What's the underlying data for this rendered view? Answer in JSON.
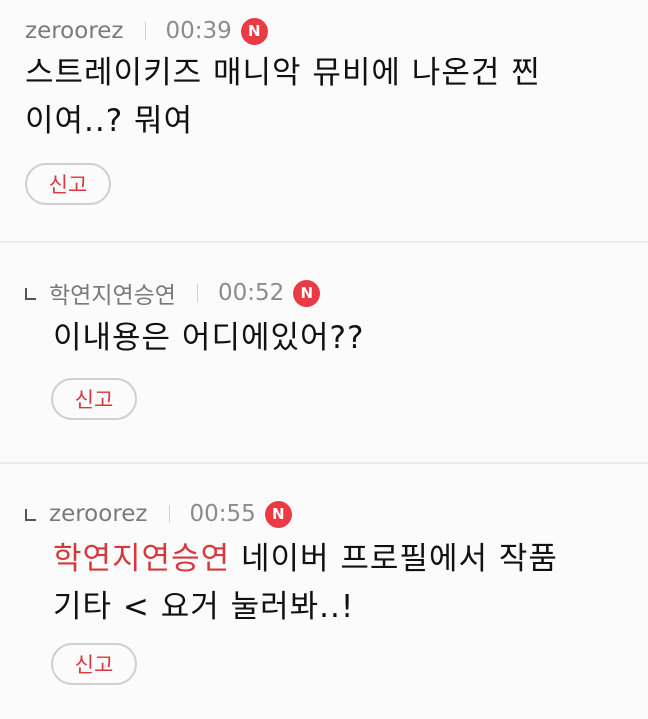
{
  "comments": [
    {
      "author": "zeroorez",
      "time": "00:39",
      "badge": "N",
      "text": "스트레이키즈 매니악 뮤비에 나온건 찐이여..? 뭐여",
      "line1": "스트레이키즈 매니악 뮤비에 나온건 찐",
      "line2": "이여..? 뭐여",
      "report_label": "신고"
    },
    {
      "author": "학연지연승연",
      "time": "00:52",
      "badge": "N",
      "text": "이내용은 어디에있어??",
      "report_label": "신고"
    },
    {
      "author": "zeroorez",
      "time": "00:55",
      "badge": "N",
      "mention": "학연지연승연",
      "line1_rest": " 네이버 프로필에서 작품",
      "line2": "기타 < 요거 눌러봐..!",
      "report_label": "신고"
    }
  ]
}
